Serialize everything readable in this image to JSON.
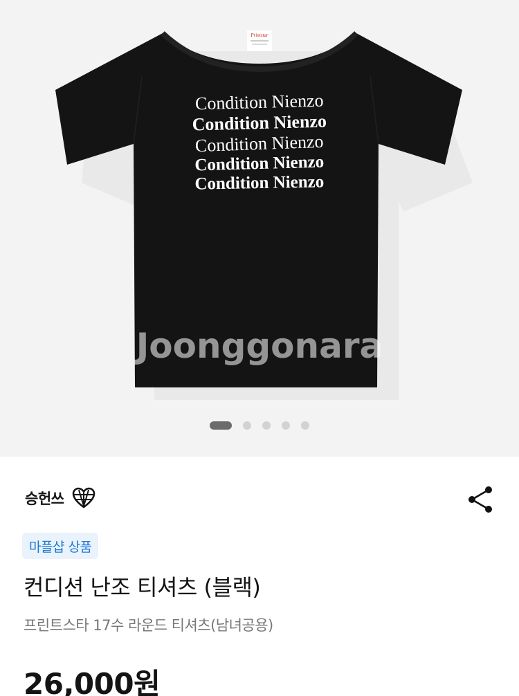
{
  "product_image": {
    "shirt_print_lines": [
      "Condition Nienzo",
      "Condition Nienzo",
      "Condition Nienzo",
      "Condition Nienzo",
      "Condition Nienzo"
    ],
    "neck_label": "Printstar",
    "watermark": "Joonggonara",
    "shirt_color": "#141414",
    "background_color": "#f3f3f3"
  },
  "carousel": {
    "total": 5,
    "active_index": 0
  },
  "seller": {
    "name": "승헌쓰",
    "badge_icon": "heart-globe-icon"
  },
  "share": {
    "icon": "share-icon"
  },
  "tag": {
    "label": "마플샵 상품",
    "color": "#1d78d4"
  },
  "product": {
    "title": "컨디션 난조 티셔츠 (블랙)",
    "subtitle": "프린트스타 17수 라운드 티셔츠(남녀공용)",
    "price": "26,000원"
  }
}
